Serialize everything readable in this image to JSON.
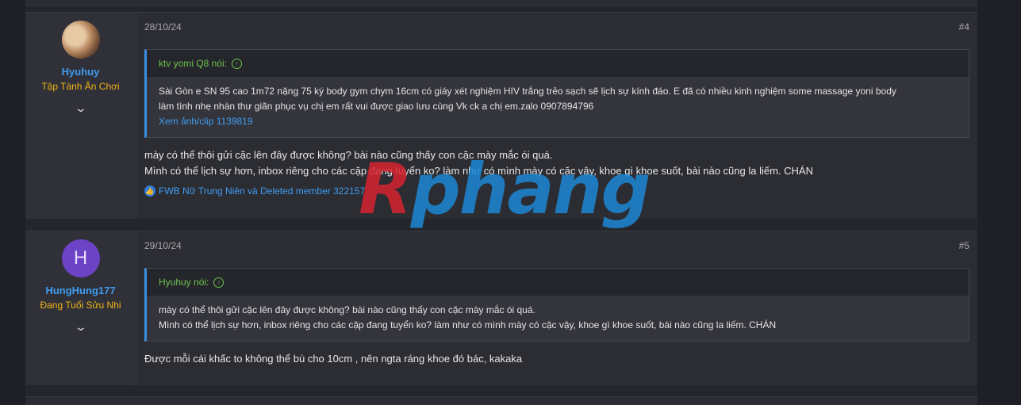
{
  "posts": [
    {
      "date": "28/10/24",
      "number": "#4",
      "user": {
        "name": "Hyuhuy",
        "title": "Tập Tành Ăn Chơi",
        "avatar_icon": "user-photo-avatar"
      },
      "quote": {
        "author_line": "ktv yomi Q8 nói:",
        "line1": "Sài Gòn e SN 95 cao 1m72 nặng 75 ký body gym chym 16cm có giáy xét nghiệm HIV trắng trẻo sạch sẽ lịch sự kính đáo. E đã có nhiều kinh nghiệm some massage yoni body",
        "line2": "làm tình nhẹ nhàn thư giãn phục vụ chị em rất vui được giao lưu cùng Vk ck a chị em.zalo 0907894796",
        "link": "Xem ảnh/clip 1139819"
      },
      "text_line1": "mày có thể thôi gửi cặc lên đây được không? bài nào cũng thấy con cặc mày mắc ói quá.",
      "text_line2": "Mình có thể lịch sự hơn, inbox riêng cho các cặp đang tuyển ko? làm như có mình mày có cặc vậy, khoe gì khoe suốt, bài nào cũng la liếm. CHÁN",
      "reactions": "FWB Nữ Trung Niên và Deleted member 322157"
    },
    {
      "date": "29/10/24",
      "number": "#5",
      "user": {
        "name": "HungHung177",
        "title": "Đang Tuổi Sửu Nhi",
        "avatar_letter": "H"
      },
      "quote": {
        "author_line": "Hyuhuy nói:",
        "line1": "mày có thể thôi gửi cặc lên đây được không? bài nào cũng thấy con cặc mày mắc ói quá.",
        "line2": "Mình có thể lịch sự hơn, inbox riêng cho các cặp đang tuyển ko? làm như có mình mày có cặc vậy, khoe gì khoe suốt, bài nào cũng la liếm. CHÁN"
      },
      "text_line1": "Được mỗi cái khấc to không thể bù cho 10cm , nên ngta ráng khoe đó bác, kakaka"
    }
  ],
  "watermark": {
    "first": "R",
    "rest": "phang"
  },
  "colors": {
    "link": "#3f9cf0",
    "user_title": "#f2b416",
    "quote_author": "#6cc24a",
    "avatar_letter_bg": "#6b43c4"
  }
}
